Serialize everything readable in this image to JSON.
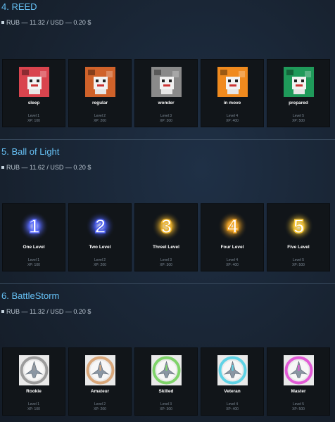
{
  "sections": [
    {
      "title": "4. REED",
      "price": "RUB — 11.32 / USD — 0.20 $",
      "badges": [
        {
          "name": "sleep",
          "level": "Level 1",
          "xp": "XP: 100",
          "color": "#d9444e",
          "icon": "reed-sleep-icon"
        },
        {
          "name": "regular",
          "level": "Level 2",
          "xp": "XP: 200",
          "color": "#d0622a",
          "icon": "reed-regular-icon"
        },
        {
          "name": "wonder",
          "level": "Level 3",
          "xp": "XP: 300",
          "color": "#8a8a8a",
          "icon": "reed-wonder-icon"
        },
        {
          "name": "in move",
          "level": "Level 4",
          "xp": "XP: 400",
          "color": "#f08a1e",
          "icon": "reed-in-move-icon"
        },
        {
          "name": "prepared",
          "level": "Level 5",
          "xp": "XP: 500",
          "color": "#1f9a5a",
          "icon": "reed-prepared-icon"
        }
      ]
    },
    {
      "title": "5. Ball of Light",
      "price": "RUB — 11.62 / USD — 0.20 $",
      "badges": [
        {
          "name": "One Level",
          "level": "Level 1",
          "xp": "XP: 100",
          "digit": "1",
          "color": "#5a6cff",
          "icon": "ball-one-icon"
        },
        {
          "name": "Two Level",
          "level": "Level 2",
          "xp": "XP: 200",
          "digit": "2",
          "color": "#4a5ef0",
          "icon": "ball-two-icon"
        },
        {
          "name": "Threel Level",
          "level": "Level 3",
          "xp": "XP: 300",
          "digit": "3",
          "color": "#f0b429",
          "icon": "ball-three-icon"
        },
        {
          "name": "Four Level",
          "level": "Level 4",
          "xp": "XP: 400",
          "digit": "4",
          "color": "#f5a623",
          "icon": "ball-four-icon"
        },
        {
          "name": "Five Level",
          "level": "Level 5",
          "xp": "XP: 500",
          "digit": "5",
          "color": "#f2c230",
          "icon": "ball-five-icon"
        }
      ]
    },
    {
      "title": "6. BattleStorm",
      "price": "RUB — 11.32 / USD — 0.20 $",
      "badges": [
        {
          "name": "Rookie",
          "level": "Level 1",
          "xp": "XP: 100",
          "color": "#9c9c9c",
          "icon": "ship-rookie-icon"
        },
        {
          "name": "Amateur",
          "level": "Level 2",
          "xp": "XP: 200",
          "color": "#d9a77a",
          "icon": "ship-amateur-icon"
        },
        {
          "name": "Skilled",
          "level": "Level 3",
          "xp": "XP: 300",
          "color": "#7fd36a",
          "icon": "ship-skilled-icon"
        },
        {
          "name": "Veteran",
          "level": "Level 4",
          "xp": "XP: 400",
          "color": "#5fd3e6",
          "icon": "ship-veteran-icon"
        },
        {
          "name": "Master",
          "level": "Level 5",
          "xp": "XP: 500",
          "color": "#e25ad6",
          "icon": "ship-master-icon"
        }
      ]
    }
  ]
}
